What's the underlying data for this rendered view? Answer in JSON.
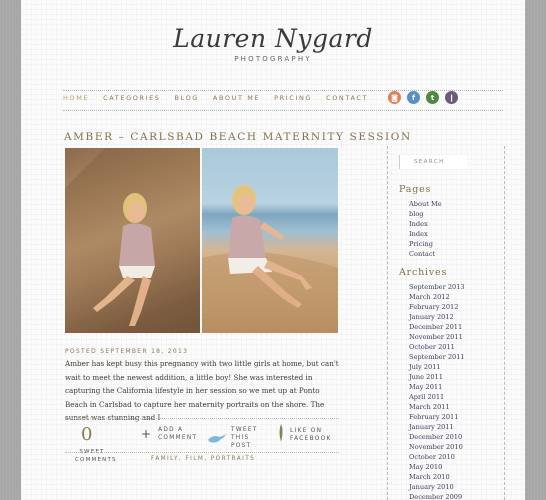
{
  "logo": {
    "name": "Lauren Nygard",
    "tagline": "PHOTOGRAPHY"
  },
  "nav": [
    "HOME",
    "CATEGORIES",
    "BLOG",
    "ABOUT ME",
    "PRICING",
    "CONTACT"
  ],
  "social": [
    {
      "name": "instagram",
      "color": "#d9825b",
      "glyph": "◙"
    },
    {
      "name": "facebook",
      "color": "#5b8fc4",
      "glyph": "f"
    },
    {
      "name": "twitter",
      "color": "#4f8a3e",
      "glyph": "t"
    },
    {
      "name": "rss",
      "color": "#6b5a7e",
      "glyph": "❙"
    }
  ],
  "post": {
    "title": "AMBER – CARLSBAD BEACH MATERNITY SESSION",
    "meta": "POSTED SEPTEMBER 18, 2013",
    "body": "Amber has kept busy this pregnancy with two little girls at home, but can't wait to meet the newest addition, a little boy! She was interested in capturing the California lifestyle in her session so we met up at Ponto Beach in Carlsbad to capture her maternity portraits on the shore. The sunset was stunning and I",
    "comments_count": "0",
    "comments_label": "SWEET COMMENTS",
    "add_comment": "ADD A COMMENT",
    "tweet": "TWEET THIS POST",
    "like": "LIKE ON FACEBOOK",
    "tags": "FAMILY, FILM, PORTRAITS"
  },
  "sidebar": {
    "search_placeholder": "SEARCH",
    "pages_heading": "Pages",
    "pages": [
      "About Me",
      "blog",
      "Index",
      "Index",
      "Pricing",
      "Contact"
    ],
    "archives_heading": "Archives",
    "archives": [
      "September 2013",
      "March 2012",
      "February 2012",
      "January 2012",
      "December 2011",
      "November 2011",
      "October 2011",
      "September 2011",
      "July 2011",
      "June 2011",
      "May 2011",
      "April 2011",
      "March 2011",
      "February 2011",
      "January 2011",
      "December 2010",
      "November 2010",
      "October 2010",
      "May 2010",
      "March 2010",
      "January 2010",
      "December 2009"
    ]
  }
}
